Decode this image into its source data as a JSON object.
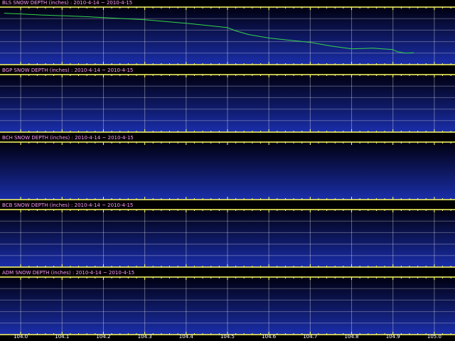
{
  "chart_data": [
    {
      "type": "line",
      "title": "BLS SNOW DEPTH (inches) : 2010-4-14 ~ 2010-4-15",
      "xlim": [
        103.95,
        105.05
      ],
      "x_ticks": [
        104.0,
        104.1,
        104.2,
        104.3,
        104.4,
        104.5,
        104.6,
        104.7,
        104.8,
        104.9,
        105.0
      ],
      "grid": true,
      "line_color": "#34d34a",
      "series": [
        {
          "x": [
            103.96,
            104.0,
            104.05,
            104.1,
            104.15,
            104.2,
            104.25,
            104.3,
            104.35,
            104.4,
            104.45,
            104.5,
            104.52,
            104.55,
            104.58,
            104.6,
            104.65,
            104.7,
            104.75,
            104.8,
            104.83,
            104.85,
            104.9,
            104.91,
            104.93,
            104.95
          ],
          "y": [
            0.98,
            0.96,
            0.93,
            0.91,
            0.89,
            0.86,
            0.83,
            0.8,
            0.75,
            0.7,
            0.64,
            0.58,
            0.49,
            0.39,
            0.33,
            0.29,
            0.23,
            0.17,
            0.07,
            -0.01,
            0.0,
            0.01,
            -0.03,
            -0.09,
            -0.13,
            -0.12
          ]
        }
      ]
    },
    {
      "type": "line",
      "title": "BGP SNOW DEPTH (inches) : 2010-4-14 ~ 2010-4-15",
      "xlim": [
        103.95,
        105.05
      ],
      "grid": true,
      "series": []
    },
    {
      "type": "line",
      "title": "BCH SNOW DEPTH (inches) : 2010-4-14 ~ 2010-4-15",
      "xlim": [
        103.95,
        105.05
      ],
      "grid": false,
      "series": []
    },
    {
      "type": "line",
      "title": "BCB SNOW DEPTH (inches) : 2010-4-14 ~ 2010-4-15",
      "xlim": [
        103.95,
        105.05
      ],
      "grid": true,
      "series": []
    },
    {
      "type": "line",
      "title": "ADM SNOW DEPTH (inches) : 2010-4-14 ~ 2010-4-15",
      "xlim": [
        103.95,
        105.05
      ],
      "grid": true,
      "series": []
    }
  ],
  "x_axis": {
    "tick_labels": [
      "104.0",
      "104.1",
      "104.2",
      "104.3",
      "104.4",
      "104.5",
      "104.6",
      "104.7",
      "104.8",
      "104.9",
      "105.0"
    ]
  },
  "colors": {
    "frame": "#ffff66",
    "grid": "#ffffff",
    "title": "#ff9cff",
    "panel_top": "#000010",
    "panel_bottom": "#1a2eaa"
  }
}
